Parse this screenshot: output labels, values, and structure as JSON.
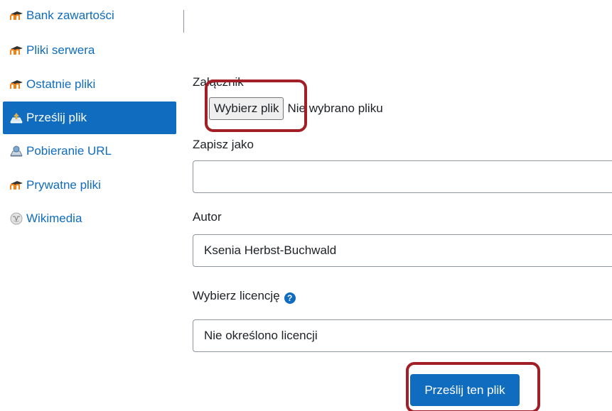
{
  "sidebar": {
    "items": [
      {
        "label": "Bank zawartości",
        "icon": "moodle-icon",
        "active": false
      },
      {
        "label": "Pliki serwera",
        "icon": "moodle-icon",
        "active": false
      },
      {
        "label": "Ostatnie pliki",
        "icon": "moodle-icon",
        "active": false
      },
      {
        "label": "Prześlij plik",
        "icon": "upload-icon",
        "active": true
      },
      {
        "label": "Pobieranie URL",
        "icon": "url-download-icon",
        "active": false
      },
      {
        "label": "Prywatne pliki",
        "icon": "moodle-icon",
        "active": false
      },
      {
        "label": "Wikimedia",
        "icon": "wikimedia-icon",
        "active": false
      }
    ]
  },
  "form": {
    "attachment_label": "Załącznik",
    "choose_file_label": "Wybierz plik",
    "no_file_text": "Nie wybrano pliku",
    "save_as_label": "Zapisz jako",
    "save_as_value": "",
    "author_label": "Autor",
    "author_value": "Ksenia Herbst-Buchwald",
    "license_label": "Wybierz licencję",
    "license_value": "Nie określono licencji",
    "submit_label": "Prześlij ten plik"
  },
  "colors": {
    "brand": "#0f6cbf",
    "moodle_orange": "#f98012",
    "moodle_dark": "#333333",
    "highlight": "#a31f27"
  }
}
